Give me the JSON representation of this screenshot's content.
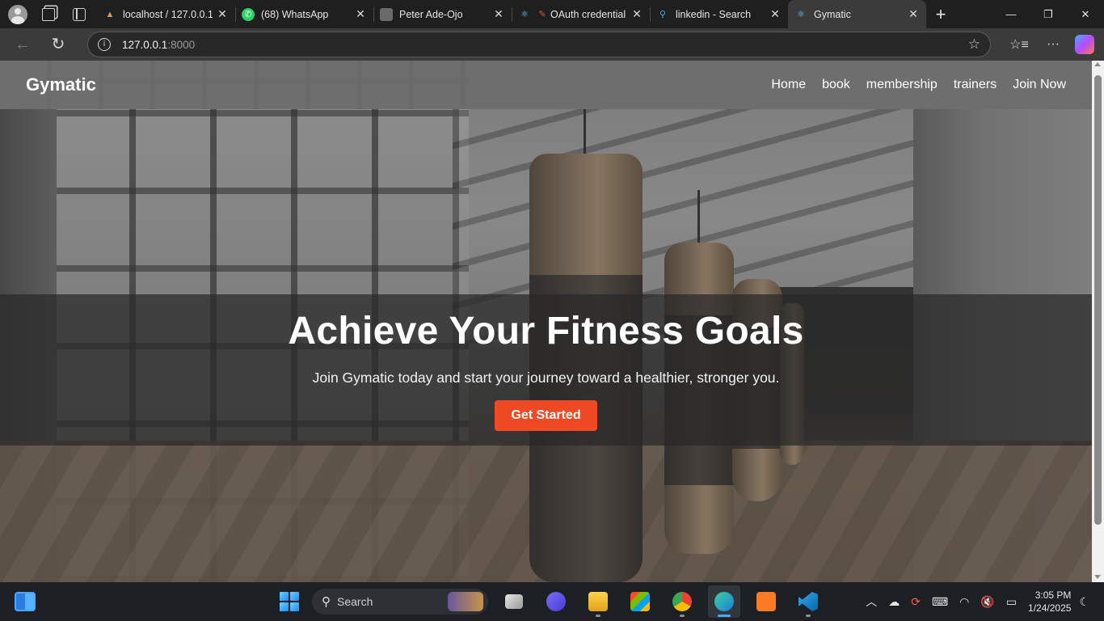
{
  "browser": {
    "tabs": [
      {
        "title": "localhost / 127.0.0.1",
        "favicon": "phpmyadmin-icon",
        "active": false
      },
      {
        "title": "(68) WhatsApp",
        "favicon": "whatsapp-icon",
        "active": false
      },
      {
        "title": "Peter Ade-Ojo",
        "favicon": "profile-thumbnail-icon",
        "active": false
      },
      {
        "title": "OAuth credential",
        "favicon": "react-icon",
        "active": false
      },
      {
        "title": "linkedin - Search",
        "favicon": "search-icon",
        "active": false
      },
      {
        "title": "Gymatic",
        "favicon": "react-icon",
        "active": true
      }
    ],
    "address": {
      "host": "127.0.0.1",
      "port": ":8000"
    }
  },
  "site": {
    "brand": "Gymatic",
    "nav": [
      "Home",
      "book",
      "membership",
      "trainers",
      "Join Now"
    ],
    "hero": {
      "title": "Achieve Your Fitness Goals",
      "subtitle": "Join Gymatic today and start your journey toward a healthier, stronger you.",
      "cta": "Get Started"
    },
    "colors": {
      "accent": "#f04a25",
      "nav_bg": "#6e6e6e"
    }
  },
  "taskbar": {
    "search_placeholder": "Search",
    "time": "3:05 PM",
    "date": "1/24/2025",
    "apps": [
      "file-explorer-icon",
      "store-icon",
      "chrome-icon",
      "edge-icon",
      "xampp-icon",
      "vscode-icon"
    ]
  }
}
